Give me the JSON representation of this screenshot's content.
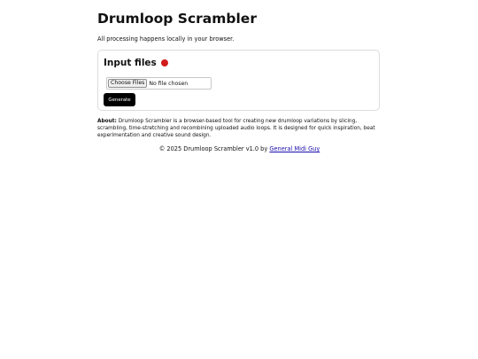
{
  "header": {
    "title": "Drumloop Scrambler",
    "subtitle": "All processing happens locally in your browser."
  },
  "input_card": {
    "title": "Input files",
    "status_color": "#d21b1b",
    "file_button_label": "Choose Files",
    "file_status": "No file chosen",
    "generate_label": "Generate"
  },
  "about": {
    "label": "About:",
    "text": "Drumloop Scrambler is a browser-based tool for creating new drumloop variations by slicing, scrambling, time-stretching and recombining uploaded audio loops. It is designed for quick inspiration, beat experimentation and creative sound design."
  },
  "footer": {
    "text": "© 2025 Drumloop Scrambler v1.0 by",
    "link_text": "General Midi Guy"
  }
}
